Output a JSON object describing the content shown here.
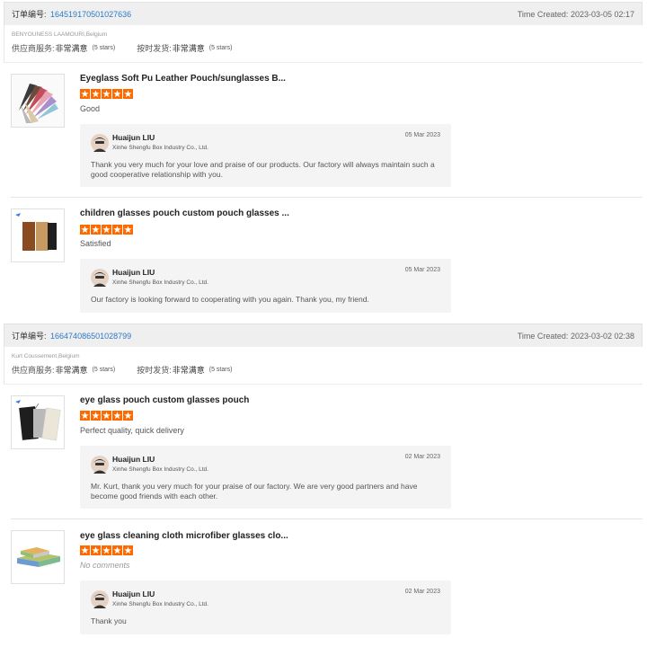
{
  "orders": [
    {
      "label": "订单编号:",
      "number": "164519170501027636",
      "time_label": "Time Created:",
      "time_value": "2023-03-05 02:17",
      "buyer": "BENYOUNESS LAAMOURI,Belgium",
      "ratings": [
        {
          "label": "供应商服务:",
          "value": "非常满意",
          "stars_text": "(5 stars)"
        },
        {
          "label": "按时发货:",
          "value": "非常满意",
          "stars_text": "(5 stars)"
        }
      ],
      "reviews": [
        {
          "product": "Eyeglass Soft Pu Leather Pouch/sunglasses B...",
          "stars": 5,
          "comment": "Good",
          "reply": {
            "name": "Huaijun LIU",
            "company": "Xinhe Shengfu Box Industry Co., Ltd.",
            "date": "05 Mar 2023",
            "text": "Thank you very much for your love and praise of our products. Our factory will always maintain such a good cooperative relationship with you."
          }
        },
        {
          "product": "children glasses pouch custom pouch glasses ...",
          "stars": 5,
          "comment": "Satisfied",
          "reply": {
            "name": "Huaijun LIU",
            "company": "Xinhe Shengfu Box Industry Co., Ltd.",
            "date": "05 Mar 2023",
            "text": "Our factory is looking forward to cooperating with you again. Thank you, my friend."
          }
        }
      ]
    },
    {
      "label": "订单编号:",
      "number": "166474086501028799",
      "time_label": "Time Created:",
      "time_value": "2023-03-02 02:38",
      "buyer": "Kurt Coussement,Belgium",
      "ratings": [
        {
          "label": "供应商服务:",
          "value": "非常满意",
          "stars_text": "(5 stars)"
        },
        {
          "label": "按时发货:",
          "value": "非常满意",
          "stars_text": "(5 stars)"
        }
      ],
      "reviews": [
        {
          "product": "eye glass pouch custom glasses pouch",
          "stars": 5,
          "comment": "Perfect quality, quick delivery",
          "reply": {
            "name": "Huaijun LIU",
            "company": "Xinhe Shengfu Box Industry Co., Ltd.",
            "date": "02 Mar 2023",
            "text": "Mr. Kurt, thank you very much for your praise of our factory. We are very good partners and have become good friends with each other."
          }
        },
        {
          "product": "eye glass cleaning cloth microfiber glasses clo...",
          "stars": 5,
          "comment": "No comments",
          "reply": {
            "name": "Huaijun LIU",
            "company": "Xinhe Shengfu Box Industry Co., Ltd.",
            "date": "02 Mar 2023",
            "text": "Thank you"
          }
        }
      ]
    }
  ],
  "colors": {
    "star": "#ff6a00",
    "link": "#2a7ac8"
  },
  "icons": {
    "star": "star-icon",
    "avatar": "avatar-icon"
  }
}
